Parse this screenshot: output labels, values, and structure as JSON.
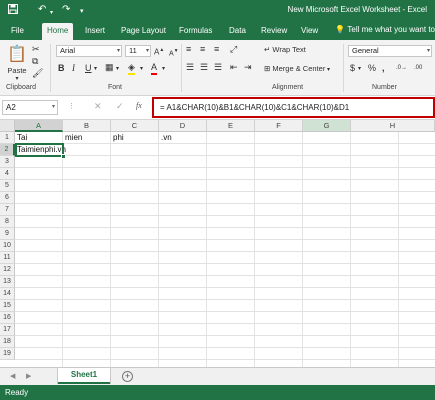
{
  "window": {
    "title": "New Microsoft Excel Worksheet - Excel",
    "accent": "#217346",
    "highlight": "#c00000"
  },
  "quick_access": {
    "save_icon": "save-icon",
    "undo_icon": "undo-icon",
    "redo_icon": "redo-icon"
  },
  "tabs": [
    {
      "label": "File"
    },
    {
      "label": "Home"
    },
    {
      "label": "Insert"
    },
    {
      "label": "Page Layout"
    },
    {
      "label": "Formulas"
    },
    {
      "label": "Data"
    },
    {
      "label": "Review"
    },
    {
      "label": "View"
    }
  ],
  "tell_me": "Tell me what you want to",
  "ribbon": {
    "paste_label": "Paste",
    "font_name": "Arial",
    "font_size": "11",
    "wrap_text": "Wrap Text",
    "merge_center": "Merge & Center",
    "number_format": "General",
    "number_currency": "$",
    "number_percent": "%",
    "number_comma": ",",
    "groups": {
      "clipboard": "Clipboard",
      "font": "Font",
      "alignment": "Alignment",
      "number": "Number"
    }
  },
  "formula_bar": {
    "name_box": "A2",
    "cancel_icon": "✕",
    "enter_icon": "✓",
    "fx": "fx",
    "formula": "= A1&CHAR(10)&B1&CHAR(10)&C1&CHAR(10)&D1"
  },
  "grid": {
    "columns": [
      "A",
      "B",
      "C",
      "D",
      "E",
      "F",
      "G",
      "H"
    ],
    "rows": [
      "1",
      "2",
      "3",
      "4",
      "5",
      "6",
      "7",
      "8",
      "9",
      "10",
      "11",
      "12",
      "13",
      "14",
      "15",
      "16",
      "17",
      "18",
      "19"
    ],
    "cells": {
      "A1": "Tai",
      "B1": "mien",
      "C1": "phi",
      "D1": ".vn",
      "A2": "Taimienphi.vn"
    },
    "active_cell": "A2"
  },
  "sheets": {
    "active": "Sheet1",
    "add_label": "+"
  },
  "status": {
    "text": "Ready"
  }
}
